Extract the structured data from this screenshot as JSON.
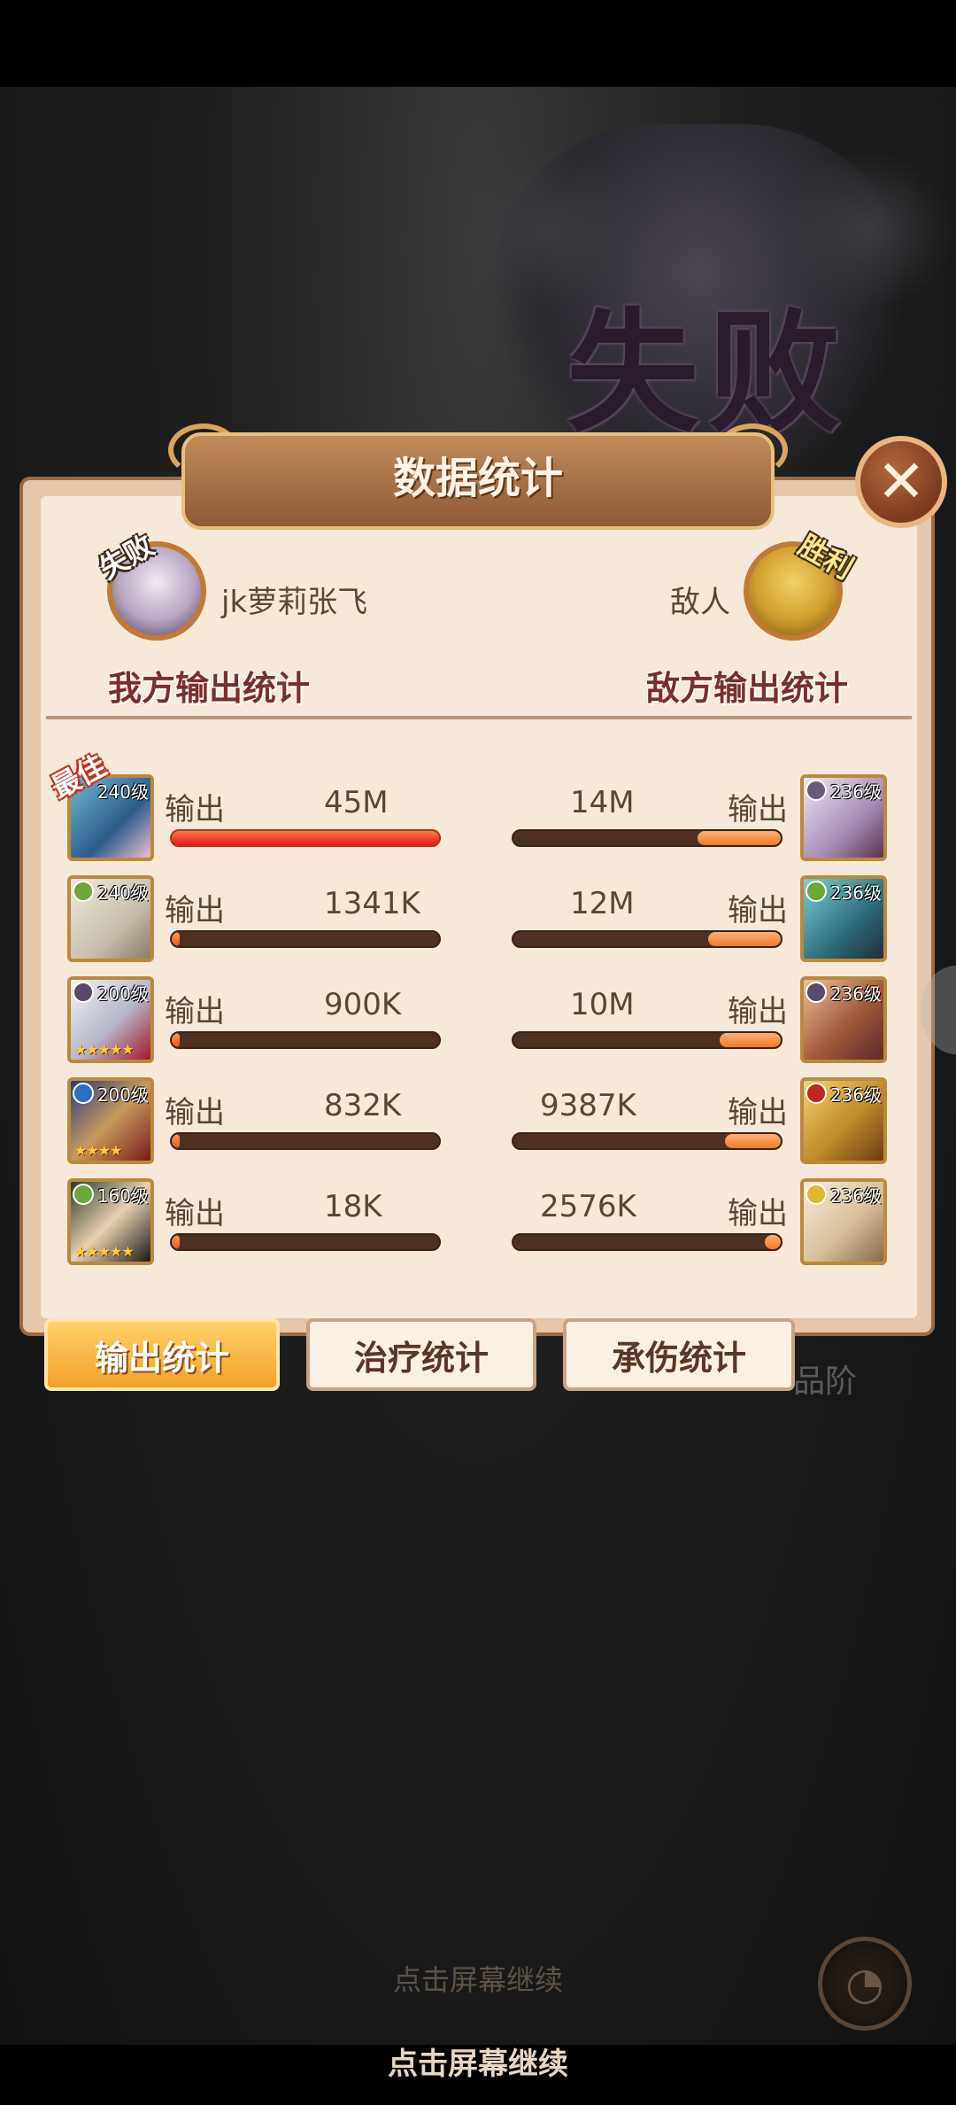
{
  "result": {
    "title": "失败"
  },
  "panel": {
    "title": "数据统计"
  },
  "players": {
    "me": {
      "name": "jk萝莉张飞",
      "stamp": "失败",
      "section_label": "我方输出统计"
    },
    "enemy": {
      "name": "敌人",
      "stamp": "胜利",
      "section_label": "敌方输出统计"
    }
  },
  "best_badge": "最佳",
  "output_label": "输出",
  "rows": [
    {
      "left": {
        "level": "240级",
        "value": "45M",
        "ratio": 1.0,
        "stars": ""
      },
      "right": {
        "level": "236级",
        "value": "14M",
        "ratio": 0.31
      }
    },
    {
      "left": {
        "level": "240级",
        "value": "1341K",
        "ratio": 0.03,
        "stars": ""
      },
      "right": {
        "level": "236级",
        "value": "12M",
        "ratio": 0.27
      }
    },
    {
      "left": {
        "level": "200级",
        "value": "900K",
        "ratio": 0.02,
        "stars": "★★★★★"
      },
      "right": {
        "level": "236级",
        "value": "10M",
        "ratio": 0.23
      }
    },
    {
      "left": {
        "level": "200级",
        "value": "832K",
        "ratio": 0.02,
        "stars": "★★★★"
      },
      "right": {
        "level": "236级",
        "value": "9387K",
        "ratio": 0.21
      }
    },
    {
      "left": {
        "level": "160级",
        "value": "18K",
        "ratio": 0.0,
        "stars": "★★★★★"
      },
      "right": {
        "level": "236级",
        "value": "2576K",
        "ratio": 0.06
      }
    }
  ],
  "tabs": {
    "output": "输出统计",
    "healing": "治疗统计",
    "damage_taken": "承伤统计"
  },
  "background_text": {
    "quality": "品阶"
  },
  "hints": {
    "faded": "点击屏幕继续",
    "main": "点击屏幕继续"
  },
  "colors": {
    "panel": "#f6e9d9",
    "accent": "#f3a129",
    "bar_fill": "#f07a2b",
    "bar_bg": "#4e3020"
  }
}
